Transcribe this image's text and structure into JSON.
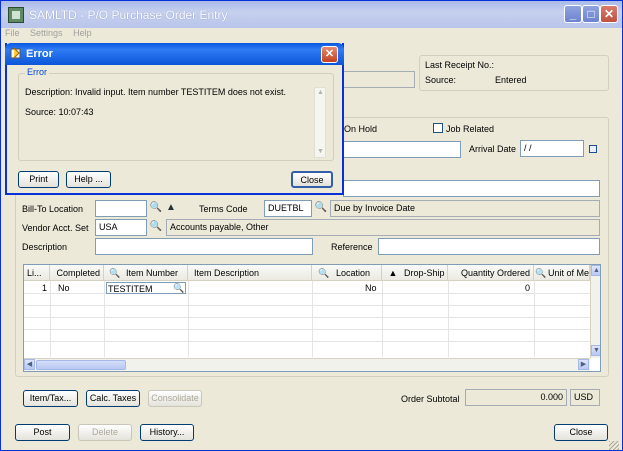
{
  "window": {
    "title": "SAMLTD - P/O Purchase Order Entry",
    "minimize": "_",
    "maximize": "□",
    "close": "✕"
  },
  "menu": [
    "File",
    "Settings",
    "Help"
  ],
  "receipt": {
    "last_receipt_label": "Last Receipt No.:",
    "last_receipt_value": "",
    "source_label": "Source:",
    "source_value": "Entered"
  },
  "form": {
    "on_hold_label": "On Hold",
    "job_related_label": "Job Related",
    "arrival_date_label": "Arrival Date",
    "arrival_date_value": " / /",
    "bill_to_location_label": "Bill-To Location",
    "bill_to_location_value": "",
    "terms_code_label": "Terms Code",
    "terms_code_value": "DUETBL",
    "terms_desc": "Due by Invoice Date",
    "vendor_acct_set_label": "Vendor Acct. Set",
    "vendor_acct_set_value": "USA",
    "vendor_acct_desc": "Accounts payable, Other",
    "description_label": "Description",
    "description_value": "",
    "reference_label": "Reference",
    "reference_value": ""
  },
  "grid": {
    "columns": [
      "Li...",
      "Completed",
      "Item Number",
      "Item Description",
      "Location",
      "Drop-Ship",
      "Quantity Ordered",
      "Unit of Measure"
    ],
    "rows": [
      {
        "line": "1",
        "completed": "No",
        "item_number": "TESTITEM",
        "item_description": "",
        "location": "",
        "drop_ship": "No",
        "qty_ordered": "0",
        "uom": ""
      }
    ]
  },
  "bottom": {
    "item_tax_button": "Item/Tax...",
    "calc_taxes_button": "Calc. Taxes",
    "consolidate_button": "Consolidate",
    "order_subtotal_label": "Order Subtotal",
    "order_subtotal_value": "0.000",
    "currency": "USD",
    "post_button": "Post",
    "delete_button": "Delete",
    "history_button": "History...",
    "close_button": "Close"
  },
  "error_dialog": {
    "title": "Error",
    "group_label": "Error",
    "description": "Description: Invalid input. Item number TESTITEM does not exist.",
    "source": "Source:   10:07:43",
    "print_button": "Print",
    "help_button": "Help ...",
    "close_button": "Close"
  },
  "colors": {
    "dialog_title": "#0b55d8",
    "window_face": "#ece9d8",
    "link_blue": "#0046d5"
  }
}
